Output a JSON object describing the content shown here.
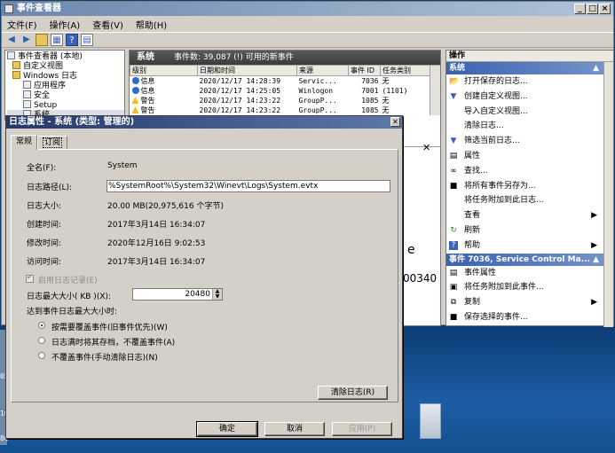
{
  "window": {
    "title": "事件查看器",
    "controls": [
      "_",
      "□",
      "×"
    ]
  },
  "menu": [
    "文件(F)",
    "操作(A)",
    "查看(V)",
    "帮助(H)"
  ],
  "toolbar": {
    "icons": [
      "back-arrow-icon",
      "forward-arrow-icon",
      "up-folder-icon",
      "show-hide-icon",
      "help-icon",
      "properties-icon"
    ]
  },
  "tree": [
    {
      "label": "事件查看器 (本地)",
      "icon": "event-viewer-icon"
    },
    {
      "label": "自定义视图",
      "icon": "folder-icon"
    },
    {
      "label": "Windows 日志",
      "icon": "folder-icon"
    },
    {
      "label": "应用程序",
      "icon": "log-icon"
    },
    {
      "label": "安全",
      "icon": "log-icon"
    },
    {
      "label": "Setup",
      "icon": "log-icon"
    },
    {
      "label": "系统",
      "icon": "log-icon"
    }
  ],
  "center": {
    "header": {
      "title": "系统",
      "count": "事件数: 39,087 (!) 可用的新事件"
    },
    "columns": [
      "级别",
      "日期和时间",
      "来源",
      "事件 ID",
      "任务类别"
    ],
    "rows": [
      {
        "level": "信息",
        "level_type": "info",
        "time": "2020/12/17 14:28:39",
        "source": "Servic...",
        "id": "7036",
        "cat": "无"
      },
      {
        "level": "信息",
        "level_type": "info",
        "time": "2020/12/17 14:25:05",
        "source": "Winlogon",
        "id": "7001",
        "cat": "(1101)"
      },
      {
        "level": "警告",
        "level_type": "warning",
        "time": "2020/12/17 14:23:22",
        "source": "GroupP...",
        "id": "1085",
        "cat": "无"
      },
      {
        "level": "警告",
        "level_type": "warning",
        "time": "2020/12/17 14:23:22",
        "source": "GroupP...",
        "id": "1085",
        "cat": "无"
      }
    ],
    "behind_fragment_e": "e",
    "behind_fragment_num": "00340"
  },
  "actions": {
    "header": "操作",
    "section1": "系统",
    "items1": [
      {
        "label": "打开保存的日志...",
        "icon": "open-folder-icon"
      },
      {
        "label": "创建自定义视图...",
        "icon": "filter-icon"
      },
      {
        "label": "导入自定义视图...",
        "icon": ""
      },
      {
        "label": "清除日志...",
        "icon": ""
      },
      {
        "label": "筛选当前日志...",
        "icon": "filter-icon"
      },
      {
        "label": "属性",
        "icon": "properties-icon"
      },
      {
        "label": "查找...",
        "icon": "binoculars-icon"
      },
      {
        "label": "将所有事件另存为...",
        "icon": "save-icon"
      },
      {
        "label": "将任务附加到此日志...",
        "icon": ""
      },
      {
        "label": "查看",
        "icon": "",
        "submenu": true
      },
      {
        "label": "刷新",
        "icon": "refresh-icon"
      },
      {
        "label": "帮助",
        "icon": "help-icon",
        "submenu": true
      }
    ],
    "section2": "事件 7036, Service Control Ma...",
    "items2": [
      {
        "label": "事件属性",
        "icon": "properties-icon"
      },
      {
        "label": "将任务附加到此事件...",
        "icon": "task-icon"
      },
      {
        "label": "复制",
        "icon": "copy-icon",
        "submenu": true
      },
      {
        "label": "保存选择的事件...",
        "icon": "save-icon"
      }
    ]
  },
  "dialog": {
    "title": "日志属性 - 系统 (类型: 管理的)",
    "tabs": [
      "常规",
      "订阅"
    ],
    "fields": {
      "full_name_label": "全名(F):",
      "full_name": "System",
      "path_label": "日志路径(L):",
      "path": "%SystemRoot%\\System32\\Winevt\\Logs\\System.evtx",
      "size_label": "日志大小:",
      "size": "20.00 MB(20,975,616 个字节)",
      "created_label": "创建时间:",
      "created": "2017年3月14日 16:34:07",
      "modified_label": "修改时间:",
      "modified": "2020年12月16日 9:02:53",
      "accessed_label": "访问时间:",
      "accessed": "2017年3月14日 16:34:07"
    },
    "enable_logging": "启用日志记录(E)",
    "max_size_label": "日志最大大小( KB )(X):",
    "max_size": "20480",
    "policy_label": "达到事件日志最大大小时:",
    "policies": [
      "按需要覆盖事件(旧事件优先)(W)",
      "日志满时将其存档，不覆盖事件(A)",
      "不覆盖事件(手动清除日志)(N)"
    ],
    "selected_policy": 0,
    "clear_button": "清除日志(R)",
    "ok_button": "确定",
    "cancel_button": "取消",
    "apply_button": "应用(P)"
  },
  "desktop": {
    "edge_labels": [
      "05",
      "10",
      "80"
    ]
  }
}
